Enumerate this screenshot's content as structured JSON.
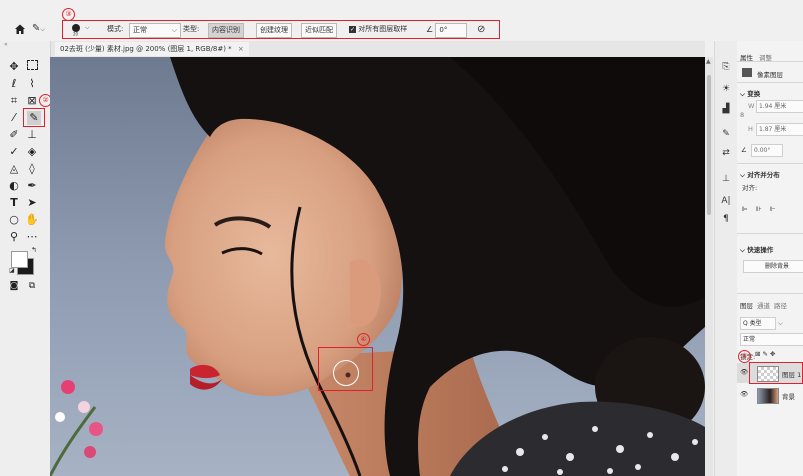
{
  "options_bar": {
    "mode_label": "模式:",
    "mode_value": "正常",
    "type_label": "类型:",
    "type_options": [
      "内容识别",
      "创建纹理",
      "近似匹配"
    ],
    "type_selected": "内容识别",
    "sample_all_layers": "对所有图层取样",
    "angle_value": "0°"
  },
  "annotations": {
    "n1": "①",
    "n2": "②",
    "n3": "③",
    "n4": "④",
    "color": "#e0202a"
  },
  "document_tab": {
    "title": "02去斑 (少量) 素材.jpg @ 200% (图层 1, RGB/8#) *",
    "close": "×"
  },
  "toolbar": {
    "tools": [
      "move",
      "marquee",
      "lasso",
      "quick-selection",
      "crop",
      "frame",
      "eyedropper",
      "spot-healing-brush",
      "brush",
      "stamp",
      "history-brush",
      "eraser",
      "gradient",
      "blur",
      "dodge",
      "pen",
      "type",
      "path-selection",
      "ellipse",
      "hand",
      "zoom",
      "more"
    ],
    "foreground_color": "#ffffff",
    "background_color": "#1a1a1a"
  },
  "properties_panel": {
    "tab_properties": "属性",
    "tab_adjustments": "调整",
    "layer_kind": "像素图层",
    "transform_title": "变换",
    "width_label": "W",
    "width_value": "1.94 厘米",
    "height_label": "H",
    "height_value": "1.87 厘米",
    "angle_value": "0.00°",
    "align_title": "对齐并分布",
    "align_label": "对齐:",
    "quick_actions_title": "快速操作",
    "quick_action_button": "删除背景"
  },
  "layers_panel": {
    "tabs": [
      "图层",
      "通道",
      "路径"
    ],
    "filter_label": "Q 类型",
    "blend_mode": "正常",
    "lock_label": "锁定:",
    "layers": [
      {
        "name": "图层 1",
        "selected": true
      },
      {
        "name": "背景",
        "selected": false
      }
    ]
  }
}
